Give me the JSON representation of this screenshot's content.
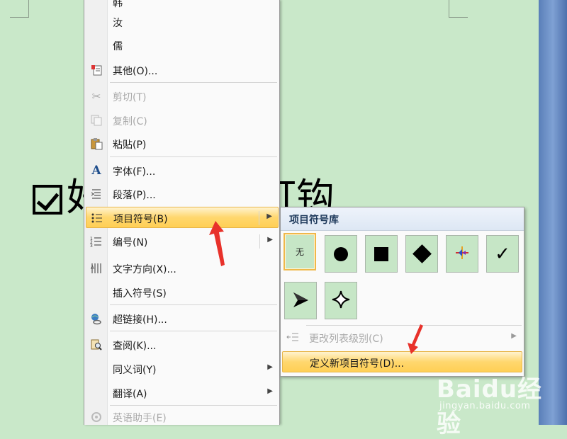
{
  "document": {
    "text": "好______中打钩"
  },
  "context_menu": {
    "items": [
      {
        "id": "char-1",
        "label": "韩",
        "icon": "",
        "disabled": false
      },
      {
        "id": "char-2",
        "label": "汝",
        "icon": "",
        "disabled": false
      },
      {
        "id": "char-3",
        "label": "儒",
        "icon": "",
        "disabled": false
      },
      {
        "id": "other",
        "label": "其他(O)...",
        "icon": "other-icon",
        "disabled": false
      },
      {
        "id": "cut",
        "label": "剪切(T)",
        "icon": "scissors-icon",
        "disabled": true
      },
      {
        "id": "copy",
        "label": "复制(C)",
        "icon": "copy-icon",
        "disabled": true
      },
      {
        "id": "paste",
        "label": "粘贴(P)",
        "icon": "paste-icon",
        "disabled": false
      },
      {
        "id": "font",
        "label": "字体(F)...",
        "icon": "font-icon",
        "disabled": false
      },
      {
        "id": "paragraph",
        "label": "段落(P)...",
        "icon": "paragraph-icon",
        "disabled": false
      },
      {
        "id": "bullets",
        "label": "项目符号(B)",
        "icon": "bullets-icon",
        "disabled": false,
        "submenu": true,
        "highlighted": true
      },
      {
        "id": "numbering",
        "label": "编号(N)",
        "icon": "numbering-icon",
        "disabled": false,
        "submenu": true
      },
      {
        "id": "text-direction",
        "label": "文字方向(X)...",
        "icon": "text-direction-icon",
        "disabled": false
      },
      {
        "id": "insert-symbol",
        "label": "插入符号(S)",
        "icon": "",
        "disabled": false
      },
      {
        "id": "hyperlink",
        "label": "超链接(H)...",
        "icon": "hyperlink-icon",
        "disabled": false
      },
      {
        "id": "lookup",
        "label": "查阅(K)...",
        "icon": "lookup-icon",
        "disabled": false
      },
      {
        "id": "synonyms",
        "label": "同义词(Y)",
        "icon": "",
        "disabled": false,
        "submenu": true
      },
      {
        "id": "translate",
        "label": "翻译(A)",
        "icon": "",
        "disabled": false,
        "submenu": true
      },
      {
        "id": "english-assistant",
        "label": "英语助手(E)",
        "icon": "assistant-icon",
        "disabled": true
      }
    ]
  },
  "submenu": {
    "title": "项目符号库",
    "glyphs": [
      {
        "name": "none",
        "label": "无",
        "selected": true
      },
      {
        "name": "filled-circle"
      },
      {
        "name": "filled-square"
      },
      {
        "name": "filled-diamond"
      },
      {
        "name": "multicolor-arrow"
      },
      {
        "name": "checkmark",
        "label": "✓"
      },
      {
        "name": "arrowhead"
      },
      {
        "name": "four-point-star"
      }
    ],
    "change_level": "更改列表级别(C)",
    "define_new": "定义新项目符号(D)..."
  },
  "watermark": {
    "brand": "Baidu经验",
    "url": "jingyan.baidu.com"
  },
  "colors": {
    "page_bg": "#c9e8c9",
    "highlight": "#ffd76e",
    "annotation_arrow": "#e8312a"
  }
}
